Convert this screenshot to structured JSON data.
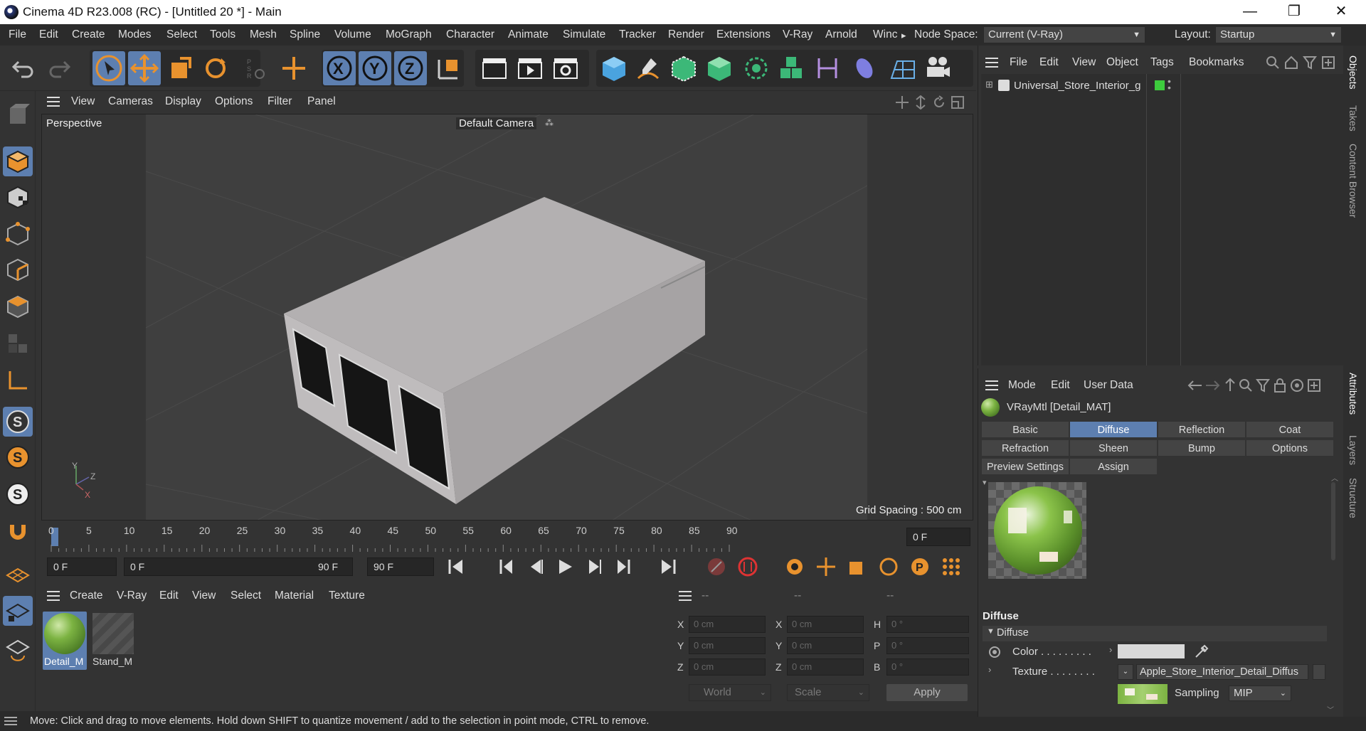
{
  "window": {
    "title": "Cinema 4D R23.008 (RC) - [Untitled 20 *] - Main",
    "minimize": "—",
    "maximize": "❐",
    "close": "✕"
  },
  "menu": {
    "items": [
      "File",
      "Edit",
      "Create",
      "Modes",
      "Select",
      "Tools",
      "Mesh",
      "Spline",
      "Volume",
      "MoGraph",
      "Character",
      "Animate",
      "Simulate",
      "Tracker",
      "Render",
      "Extensions",
      "V-Ray",
      "Arnold",
      "Winc"
    ],
    "overflow": "▸",
    "node_space_label": "Node Space:",
    "node_space_value": "Current (V-Ray)",
    "layout_label": "Layout:",
    "layout_value": "Startup"
  },
  "viewport": {
    "menu": [
      "View",
      "Cameras",
      "Display",
      "Options",
      "Filter",
      "Panel"
    ],
    "view_name": "Perspective",
    "camera": "Default Camera",
    "grid_spacing": "Grid Spacing : 500 cm",
    "axes": {
      "x": "X",
      "y": "Y",
      "z": "Z"
    }
  },
  "timeline": {
    "ticks": [
      "0",
      "5",
      "10",
      "15",
      "20",
      "25",
      "30",
      "35",
      "40",
      "45",
      "50",
      "55",
      "60",
      "65",
      "70",
      "75",
      "80",
      "85",
      "90"
    ],
    "current_frame": "0 F"
  },
  "transport": {
    "start_field": "0 F",
    "range_start": "0 F",
    "range_end": "90 F",
    "end_field": "90 F"
  },
  "material_manager": {
    "menu": [
      "Create",
      "V-Ray",
      "Edit",
      "View",
      "Select",
      "Material",
      "Texture"
    ],
    "materials": [
      {
        "name": "Detail_M",
        "selected": true
      },
      {
        "name": "Stand_M",
        "selected": false
      }
    ]
  },
  "coordinates": {
    "headers": [
      "--",
      "--",
      "--"
    ],
    "rows": [
      {
        "l1": "X",
        "v1": "0 cm",
        "l2": "X",
        "v2": "0 cm",
        "l3": "H",
        "v3": "0 °"
      },
      {
        "l1": "Y",
        "v1": "0 cm",
        "l2": "Y",
        "v2": "0 cm",
        "l3": "P",
        "v3": "0 °"
      },
      {
        "l1": "Z",
        "v1": "0 cm",
        "l2": "Z",
        "v2": "0 cm",
        "l3": "B",
        "v3": "0 °"
      }
    ],
    "space": "World",
    "mode": "Scale",
    "apply": "Apply"
  },
  "status": "Move: Click and drag to move elements. Hold down SHIFT to quantize movement / add to the selection in point mode, CTRL to remove.",
  "object_manager": {
    "menu": [
      "File",
      "Edit",
      "View",
      "Object",
      "Tags",
      "Bookmarks"
    ],
    "objects": [
      {
        "name": "Universal_Store_Interior_g",
        "color": "#3dcc3d"
      }
    ]
  },
  "attribute_manager": {
    "menu": [
      "Mode",
      "Edit",
      "User Data"
    ],
    "material_title": "VRayMtl [Detail_MAT]",
    "tabs_row1": [
      "Basic",
      "Diffuse",
      "Reflection",
      "Coat"
    ],
    "tabs_row2": [
      "Refraction",
      "Sheen",
      "Bump",
      "Options"
    ],
    "tabs_row3": [
      "Preview Settings",
      "Assign"
    ],
    "active_tab": "Diffuse",
    "section_title": "Diffuse",
    "group_title": "Diffuse",
    "color_label": "Color . . . . . . . . .",
    "color_value": "#d9d9d9",
    "texture_label": "Texture . . . . . . . .",
    "texture_value": "Apple_Store_Interior_Detail_Diffus",
    "sampling_label": "Sampling",
    "sampling_value": "MIP"
  },
  "right_tabs": [
    "Objects",
    "Takes",
    "Content Browser",
    "Attributes",
    "Layers",
    "Structure"
  ],
  "colors": {
    "accent": "#5d7fb0",
    "orange": "#e8922e",
    "background": "#333333"
  }
}
